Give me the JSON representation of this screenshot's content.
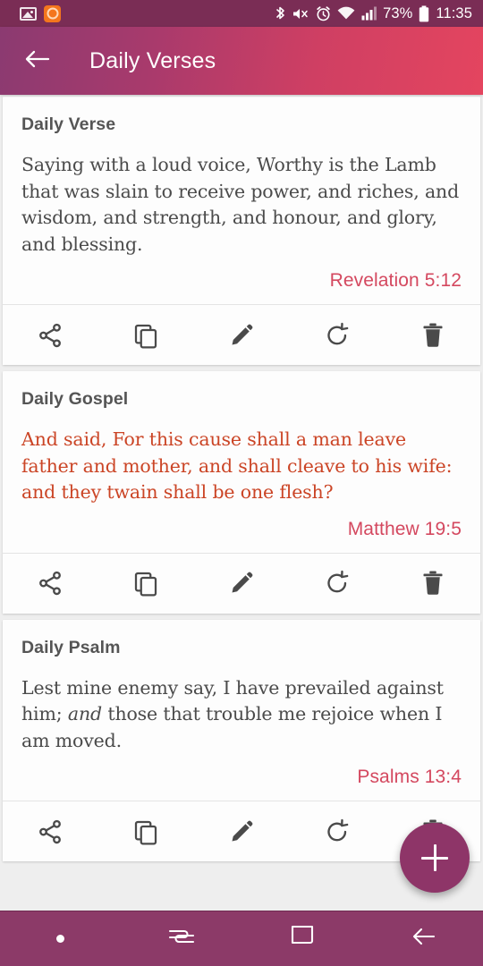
{
  "status_bar": {
    "notification_icons": [
      "image-icon",
      "app-icon"
    ],
    "system_icons": [
      "bluetooth-icon",
      "mute-icon",
      "alarm-icon",
      "wifi-icon",
      "signal-icon"
    ],
    "battery": "73%",
    "time": "11:35"
  },
  "app_bar": {
    "back_icon": "back-arrow-icon",
    "title": "Daily Verses",
    "gradient_start": "#8b3a71",
    "gradient_end": "#e4455f"
  },
  "colors": {
    "reference": "#d4485f",
    "gospel_text": "#cb4526",
    "body_text": "#4b4b4b",
    "title_text": "#555555",
    "fab": "#8e3568",
    "nav_bar": "#8c3a68",
    "status_bar": "#7a2d55"
  },
  "actions": [
    {
      "name": "share",
      "icon": "share-icon"
    },
    {
      "name": "copy",
      "icon": "copy-icon"
    },
    {
      "name": "edit",
      "icon": "pencil-icon"
    },
    {
      "name": "refresh",
      "icon": "refresh-icon"
    },
    {
      "name": "delete",
      "icon": "trash-icon"
    }
  ],
  "cards": [
    {
      "title": "Daily Verse",
      "text": "Saying with a loud voice, Worthy is the Lamb that was slain to receive power, and riches, and wisdom, and strength, and honour, and glory, and blessing.",
      "reference": "Revelation 5:12",
      "accent": false
    },
    {
      "title": "Daily Gospel",
      "text": "And said, For this cause shall a man leave father and mother, and shall cleave to his wife: and they twain shall be one flesh?",
      "reference": "Matthew 19:5",
      "accent": true
    },
    {
      "title": "Daily Psalm",
      "text_html": "Lest mine enemy say, I have prevailed against him; <em>and</em> those that trouble me rejoice when I am moved.",
      "text": "Lest mine enemy say, I have prevailed against him; and those that trouble me rejoice when I am moved.",
      "reference": "Psalms 13:4",
      "accent": false
    }
  ],
  "fab": {
    "icon": "plus-icon",
    "label": "+"
  },
  "nav_bar": {
    "items": [
      {
        "name": "dot-indicator",
        "icon": "dot-icon"
      },
      {
        "name": "recents",
        "icon": "recents-icon"
      },
      {
        "name": "home",
        "icon": "home-square-icon"
      },
      {
        "name": "back",
        "icon": "back-arrow-icon"
      }
    ]
  }
}
